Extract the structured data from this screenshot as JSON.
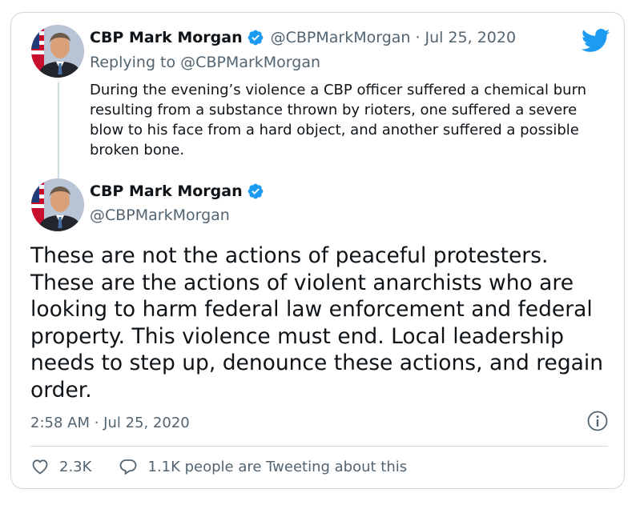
{
  "reply_tweet": {
    "display_name": "CBP Mark Morgan",
    "handle": "@CBPMarkMorgan",
    "separator": "·",
    "date": "Jul 25, 2020",
    "replying_prefix": "Replying to",
    "replying_handle": "@CBPMarkMorgan",
    "text": "During the evening’s violence a CBP officer suffered a chemical burn resulting from a substance thrown by rioters, one suffered a severe blow to his face from a hard object, and another suffered a possible broken bone.",
    "verified_icon": "verified-badge-icon",
    "brand_icon": "twitter-bird-icon"
  },
  "main_tweet": {
    "display_name": "CBP Mark Morgan",
    "handle": "@CBPMarkMorgan",
    "text": "These are not the actions of peaceful protesters. These are the actions of violent anarchists who are looking to harm federal law enforcement and federal property. This violence must end. Local leadership needs to step up, denounce these actions, and regain order.",
    "timestamp": "2:58 AM · Jul 25, 2020",
    "info_icon": "info-icon",
    "likes": "2.3K",
    "like_icon": "heart-icon",
    "tweeting_label": "1.1K people are Tweeting about this",
    "reply_icon": "speech-bubble-icon"
  },
  "colors": {
    "brand_blue": "#1d9bf0",
    "text": "#0f1419",
    "muted": "#536471",
    "border": "#cfd9de"
  }
}
